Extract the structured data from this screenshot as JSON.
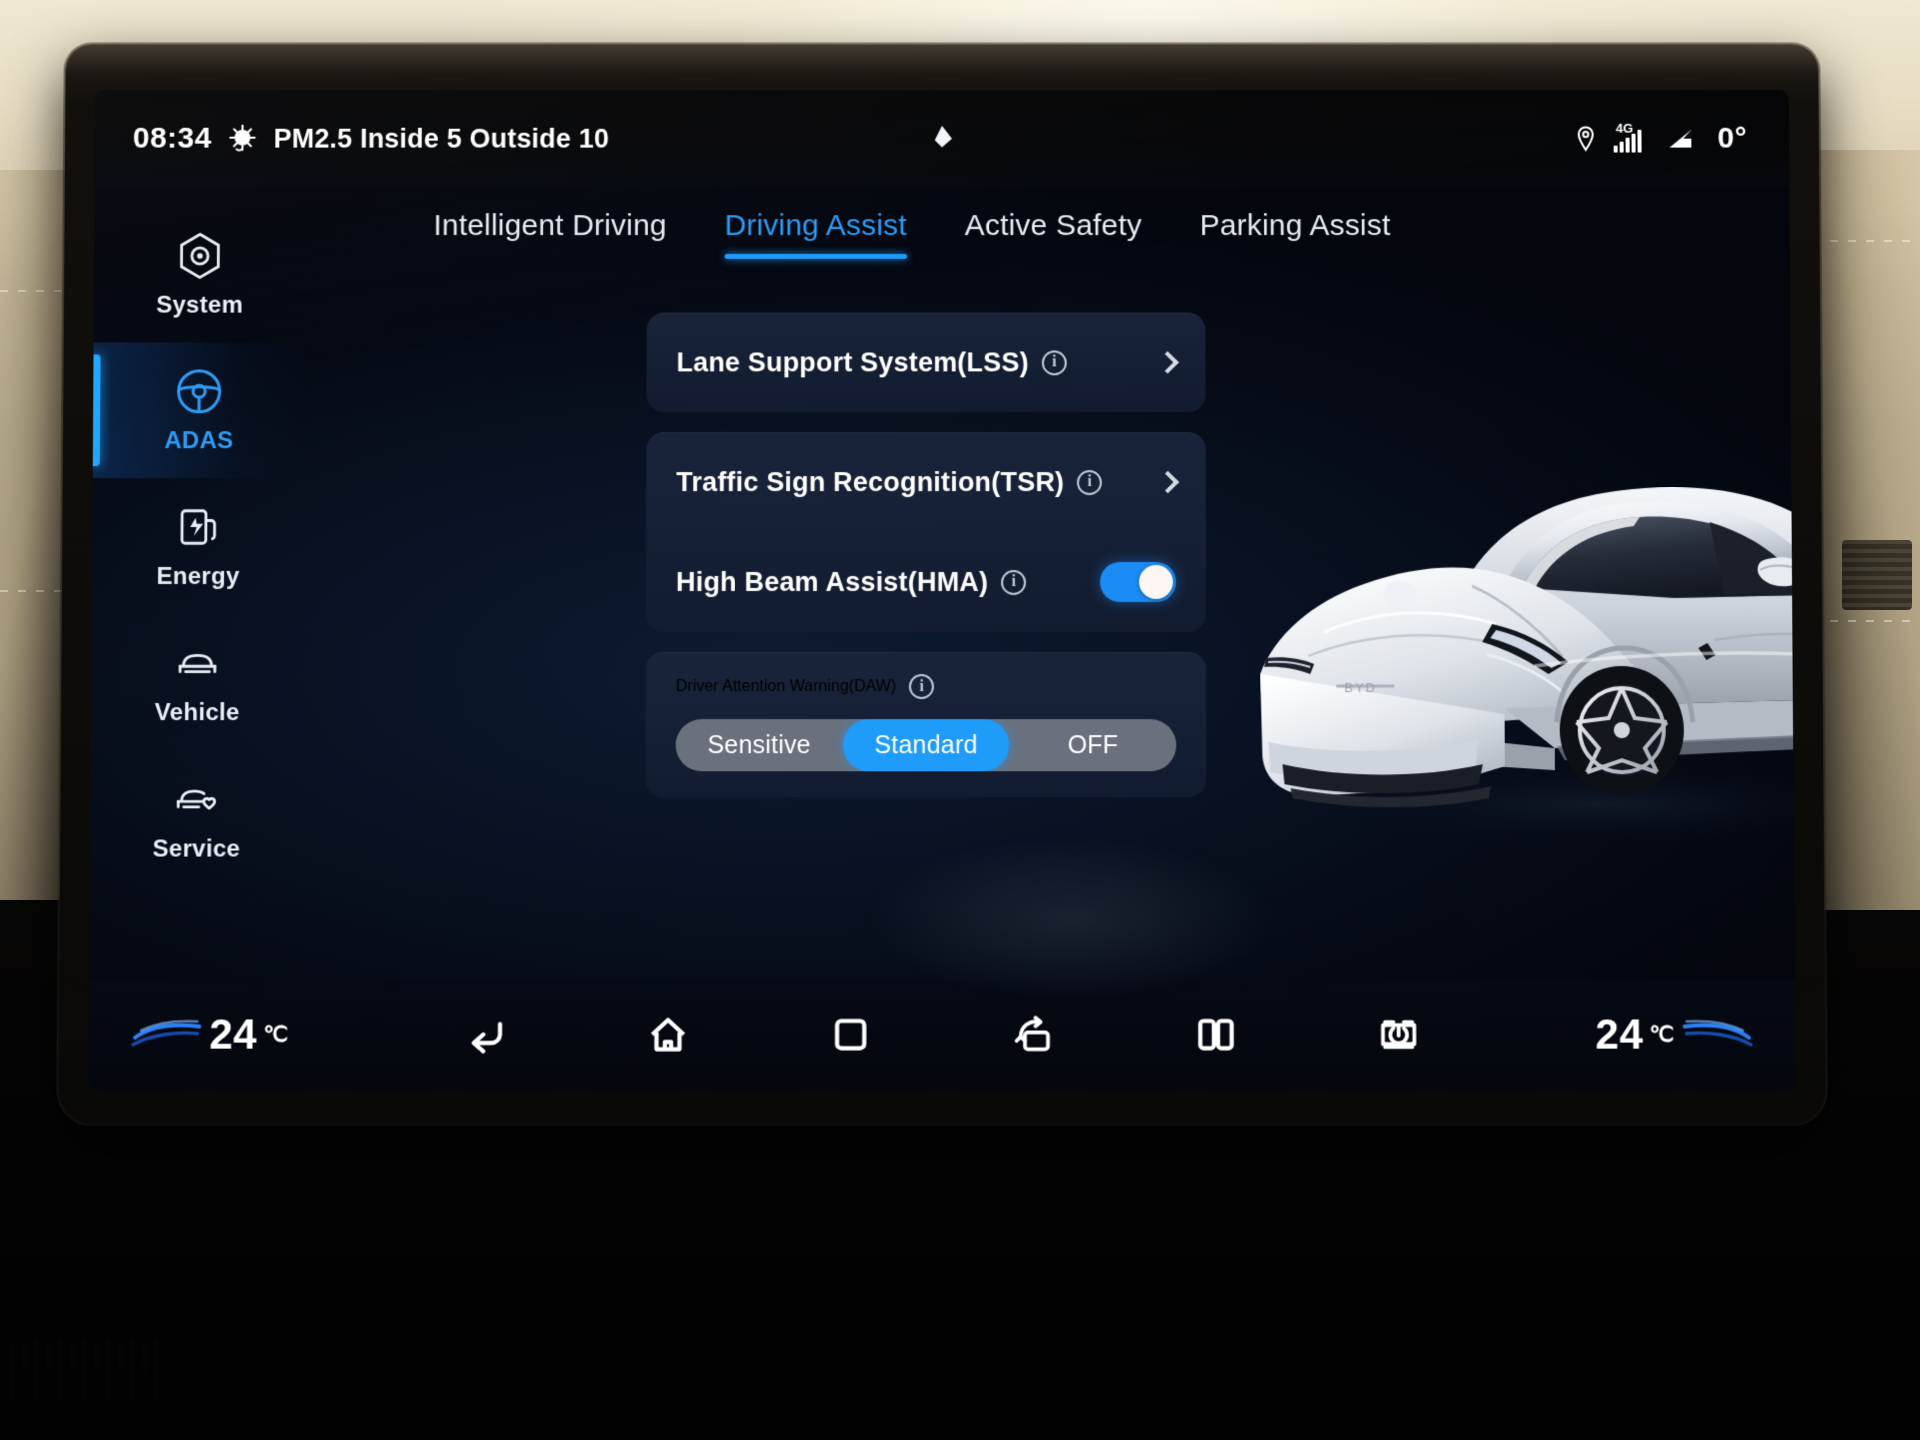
{
  "status_bar": {
    "clock": "08:34",
    "air_quality": "PM2.5 Inside 5 Outside 10",
    "air_icon": "pm25-virus-icon",
    "center_icon": "notification-icon",
    "network_label": "4G",
    "outside_temp": "0°",
    "location_icon": "location-pin-icon",
    "signal_icon": "signal-bars-icon",
    "incline_icon": "slope-incline-icon"
  },
  "sidebar": {
    "items": [
      {
        "label": "System",
        "icon": "hexagon-gear-icon",
        "active": false
      },
      {
        "label": "ADAS",
        "icon": "steering-wheel-icon",
        "active": true
      },
      {
        "label": "Energy",
        "icon": "charging-station-icon",
        "active": false
      },
      {
        "label": "Vehicle",
        "icon": "car-front-icon",
        "active": false
      },
      {
        "label": "Service",
        "icon": "car-heart-icon",
        "active": false
      }
    ]
  },
  "tabs": [
    {
      "label": "Intelligent Driving",
      "active": false
    },
    {
      "label": "Driving Assist",
      "active": true
    },
    {
      "label": "Active Safety",
      "active": false
    },
    {
      "label": "Parking Assist",
      "active": false
    }
  ],
  "settings": {
    "lane_support": {
      "title": "Lane Support System(LSS)",
      "info": "i",
      "control": "chevron"
    },
    "traffic_sign": {
      "title": "Traffic Sign Recognition(TSR)",
      "info": "i",
      "control": "chevron"
    },
    "high_beam": {
      "title": "High Beam Assist(HMA)",
      "info": "i",
      "control": "toggle",
      "state": "on"
    },
    "driver_attention": {
      "title": "Driver Attention Warning(DAW)",
      "info": "i",
      "control": "segmented",
      "options": [
        {
          "label": "Sensitive",
          "selected": false
        },
        {
          "label": "Standard",
          "selected": true
        },
        {
          "label": "OFF",
          "selected": false
        }
      ]
    }
  },
  "vehicle_image": {
    "alt": "white sedan three-quarter front view"
  },
  "nav_bar": {
    "left_temp": "24",
    "left_temp_unit": "℃",
    "right_temp": "24",
    "right_temp_unit": "℃",
    "buttons": [
      {
        "name": "back-icon"
      },
      {
        "name": "home-icon"
      },
      {
        "name": "recents-icon"
      },
      {
        "name": "screen-rotate-icon"
      },
      {
        "name": "split-screen-icon"
      },
      {
        "name": "screen-off-icon"
      }
    ]
  },
  "colors": {
    "accent": "#1f9bfa",
    "accent_bright": "#20a7ff",
    "card_bg": "#1a253c",
    "screen_bg": "#050a14",
    "text": "#ffffff",
    "segment_track": "#6a717d"
  }
}
